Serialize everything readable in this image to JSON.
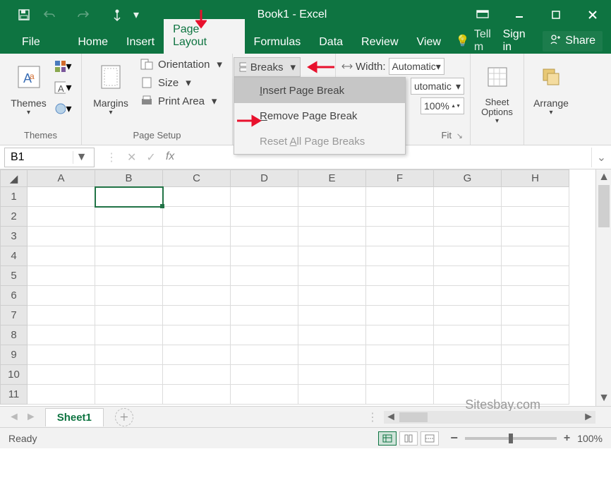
{
  "title": "Book1 - Excel",
  "tabs": {
    "file": "File",
    "home": "Home",
    "insert": "Insert",
    "pagelayout": "Page Layout",
    "formulas": "Formulas",
    "data": "Data",
    "review": "Review",
    "view": "View",
    "tellme": "Tell m",
    "signin": "Sign in",
    "share": "Share"
  },
  "ribbon": {
    "themes": {
      "label": "Themes",
      "btn": "Themes"
    },
    "pageSetup": {
      "label": "Page Setup",
      "margins": "Margins",
      "orientation": "Orientation",
      "size": "Size",
      "printArea": "Print Area",
      "breaks": "Breaks"
    },
    "breaksMenu": {
      "insert": "Insert Page Break",
      "remove": "Remove Page Break",
      "reset": "Reset All Page Breaks"
    },
    "scale": {
      "widthLabel": "Width:",
      "widthVal": "Automatic",
      "heightVal": "utomatic",
      "scaleVal": "100%",
      "fitLabel": "Fit"
    },
    "sheetOptions": "Sheet Options",
    "arrange": "Arrange"
  },
  "namebox": "B1",
  "columns": [
    "A",
    "B",
    "C",
    "D",
    "E",
    "F",
    "G",
    "H"
  ],
  "rows": [
    "1",
    "2",
    "3",
    "4",
    "5",
    "6",
    "7",
    "8",
    "9",
    "10",
    "11"
  ],
  "sheetTab": "Sheet1",
  "status": {
    "ready": "Ready",
    "zoom": "100%"
  },
  "watermark": "Sitesbay.com"
}
